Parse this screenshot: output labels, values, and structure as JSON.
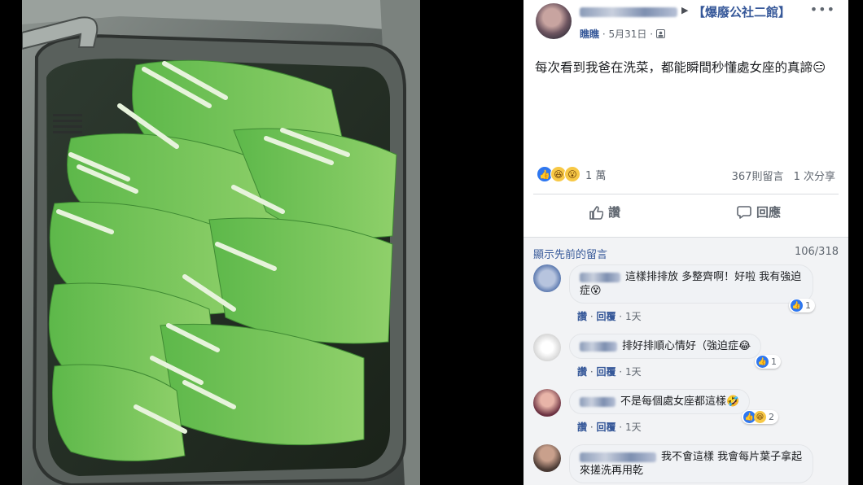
{
  "post": {
    "group_name": "【爆廢公社二館】",
    "poster": "瞧瞧",
    "date": "5月31日",
    "privacy_icon": "group-icon",
    "text": "每次看到我爸在洗菜，都能瞬間秒懂處女座的真諦😑",
    "reaction_count": "1 萬",
    "comment_count": "367則留言",
    "share_count": "1 次分享",
    "reactions": [
      "like",
      "haha",
      "wow"
    ]
  },
  "actions": {
    "like_label": "讚",
    "comment_label": "回應"
  },
  "comments": {
    "previous_label": "顯示先前的留言",
    "pager": "106/318",
    "like_label": "讚",
    "reply_label": "回覆",
    "items": [
      {
        "text": "這樣排排放 多整齊啊！好啦 我有強迫症😵",
        "reaction_count": "1",
        "time": "1天"
      },
      {
        "text": "排好排順心情好（強迫症😂",
        "reaction_count": "1",
        "time": "1天"
      },
      {
        "text": "不是每個處女座都這樣🤣",
        "reaction_count": "2",
        "time": "1天"
      },
      {
        "text": "我不會這樣 我會每片葉子拿起來搓洗再用乾",
        "reaction_count": "",
        "time": ""
      }
    ]
  },
  "colors": {
    "link": "#365899",
    "muted": "#606770",
    "like_blue": "#2e77f0"
  }
}
